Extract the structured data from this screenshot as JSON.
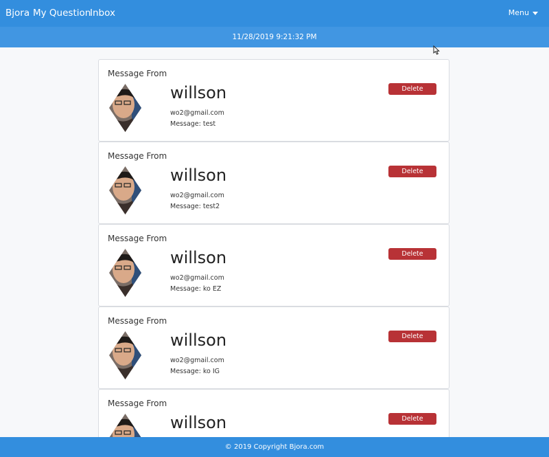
{
  "navbar": {
    "brand": "Bjora",
    "links": [
      "My Question",
      "Inbox"
    ],
    "menu_label": "Menu"
  },
  "date_bar": {
    "datetime": "11/28/2019 9:21:32 PM"
  },
  "messages": [
    {
      "header": "Message From",
      "name": "willson",
      "email": "wo2@gmail.com",
      "message_label": "Message:",
      "message": "test",
      "delete_label": "Delete"
    },
    {
      "header": "Message From",
      "name": "willson",
      "email": "wo2@gmail.com",
      "message_label": "Message:",
      "message": "test2",
      "delete_label": "Delete"
    },
    {
      "header": "Message From",
      "name": "willson",
      "email": "wo2@gmail.com",
      "message_label": "Message:",
      "message": "ko EZ",
      "delete_label": "Delete"
    },
    {
      "header": "Message From",
      "name": "willson",
      "email": "wo2@gmail.com",
      "message_label": "Message:",
      "message": "ko IG",
      "delete_label": "Delete"
    },
    {
      "header": "Message From",
      "name": "willson",
      "email": "",
      "message_label": "",
      "message": "",
      "delete_label": "Delete"
    }
  ],
  "footer": {
    "copyright": "© 2019 Copyright Bjora.com"
  },
  "colors": {
    "primary": "#338ede",
    "date_bar": "#4196e2",
    "delete": "#b83236",
    "background": "#f7f8fa"
  },
  "icons": {
    "avatar": "user-photo-diamond",
    "menu_caret": "caret-down-icon",
    "cursor": "mouse-pointer-icon"
  }
}
